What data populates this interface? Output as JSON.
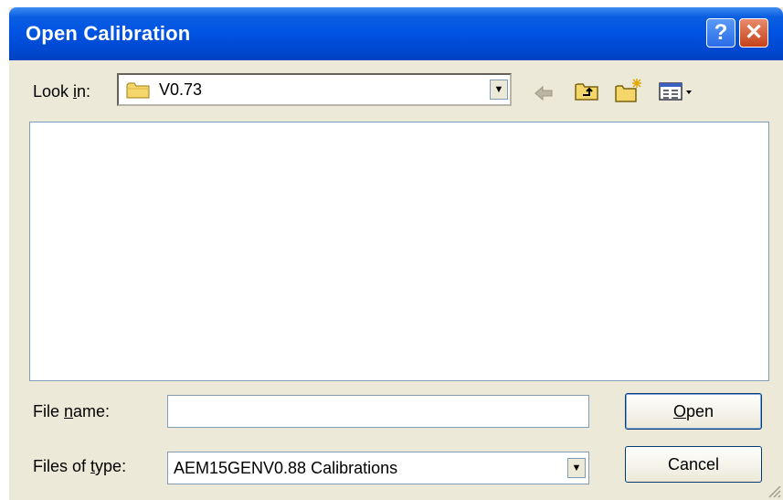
{
  "window": {
    "title": "Open Calibration",
    "help_label": "?",
    "close_label": "✕"
  },
  "lookin": {
    "label_pre": "Look ",
    "label_u": "i",
    "label_post": "n:",
    "value": "V0.73"
  },
  "toolbar": {
    "icons": [
      "back-icon",
      "up-folder-icon",
      "new-folder-icon",
      "view-menu-icon"
    ]
  },
  "filename": {
    "label_pre": "File ",
    "label_u": "n",
    "label_post": "ame:",
    "value": ""
  },
  "filetype": {
    "label_pre": "Files of ",
    "label_u": "t",
    "label_post": "ype:",
    "value": "AEM15GENV0.88  Calibrations"
  },
  "buttons": {
    "open_u": "O",
    "open_rest": "pen",
    "cancel": "Cancel"
  },
  "colors": {
    "title_bar": "#0054e3",
    "dialog_bg": "#ece9d8",
    "close_button": "#c5421a"
  }
}
